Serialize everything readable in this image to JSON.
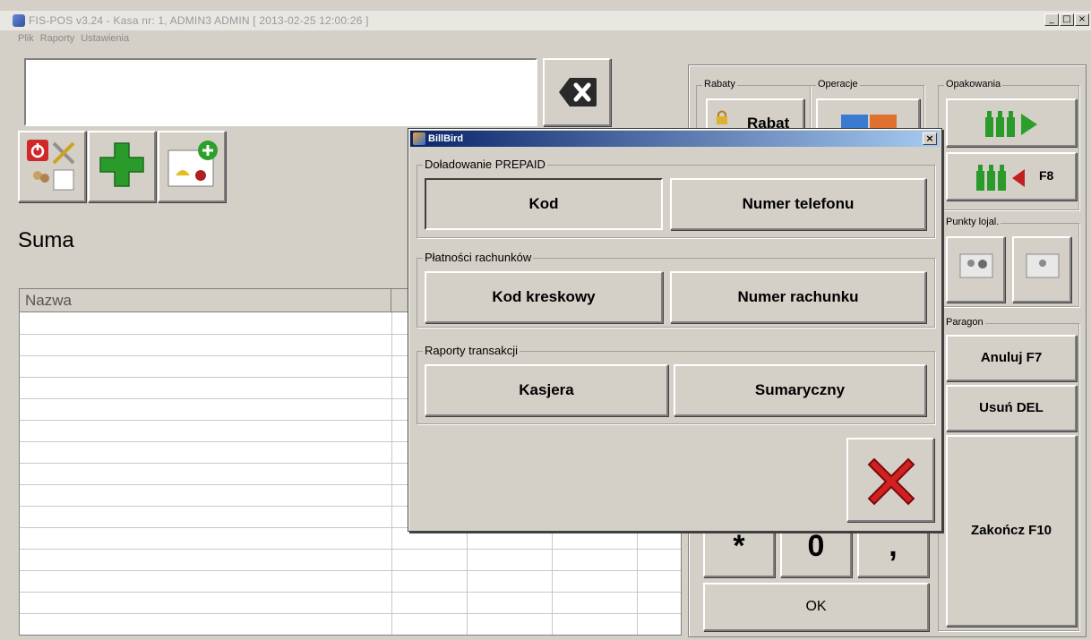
{
  "window": {
    "title": "FIS-POS v3.24 - Kasa nr: 1, ADMIN3 ADMIN [ 2013-02-25 12:00:26 ]",
    "minimize": "_",
    "maximize": "□",
    "close": "×"
  },
  "menu": [
    "Plik",
    "Raporty",
    "Ustawienia"
  ],
  "main": {
    "suma_label": "Suma",
    "table_headers": [
      "Nazwa",
      "",
      "",
      "",
      ""
    ]
  },
  "right_panel": {
    "rabaty": {
      "title": "Rabaty",
      "button": "Rabat"
    },
    "operacje": {
      "title": "Operacje"
    },
    "opakowania": {
      "title": "Opakowania",
      "return_label": "F8"
    },
    "punkty": {
      "title": "Punkty lojal."
    },
    "paragon": {
      "title": "Paragon",
      "cancel": "Anuluj F7",
      "delete": "Usuń DEL",
      "finish": "Zakończ F10"
    },
    "keypad": {
      "star": "*",
      "zero": "0",
      "comma": ",",
      "ok": "OK"
    }
  },
  "dialog": {
    "title": "BillBird",
    "close": "×",
    "groups": [
      {
        "title": "Doładowanie PREPAID",
        "buttons": [
          "Kod",
          "Numer telefonu"
        ]
      },
      {
        "title": "Płatności rachunków",
        "buttons": [
          "Kod kreskowy",
          "Numer rachunku"
        ]
      },
      {
        "title": "Raporty transakcji",
        "buttons": [
          "Kasjera",
          "Sumaryczny"
        ]
      }
    ]
  },
  "icons": {
    "backspace": "backspace-icon",
    "settings": "tools-settings-icon",
    "add": "green-plus-icon",
    "add_product": "add-product-icon",
    "cancel": "red-x-icon",
    "colors": {
      "accent_green": "#2a9a2a",
      "accent_red": "#d02020",
      "title_blue": "#0a246a"
    }
  }
}
